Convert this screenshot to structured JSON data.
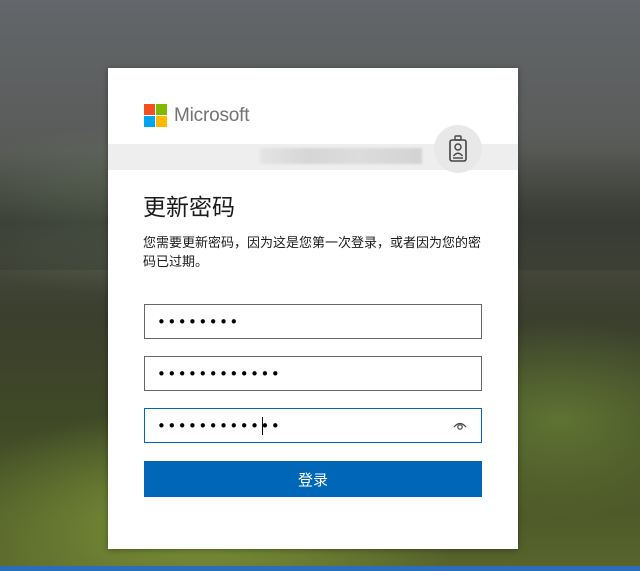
{
  "brand": {
    "name": "Microsoft",
    "colors": {
      "red": "#f25022",
      "green": "#7fba00",
      "blue": "#00a4ef",
      "yellow": "#ffb900"
    }
  },
  "identity": {
    "icon": "id-badge-icon"
  },
  "page": {
    "title": "更新密码",
    "description": "您需要更新密码，因为这是您第一次登录，或者因为您的密码已过期。"
  },
  "form": {
    "current_password": {
      "value": "••••••••"
    },
    "new_password": {
      "value": "••••••••••••"
    },
    "confirm_password": {
      "value": "••••••••••••"
    },
    "reveal_icon": "eye-icon",
    "submit_label": "登录"
  },
  "colors": {
    "accent": "#0067b8",
    "taskbar": "#2b6dbb"
  }
}
